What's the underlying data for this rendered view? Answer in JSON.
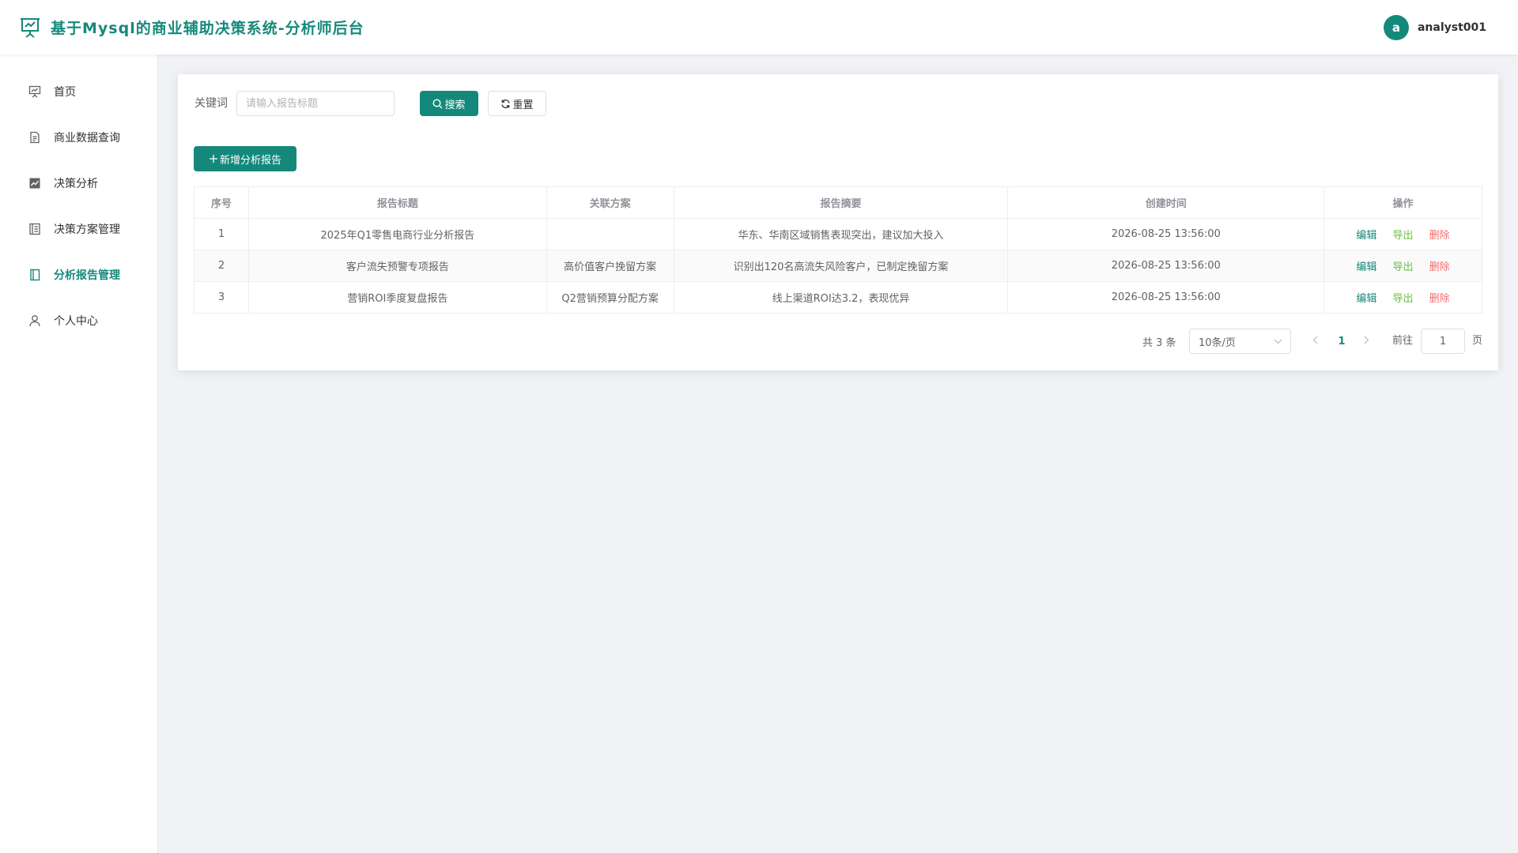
{
  "header": {
    "title": "基于Mysql的商业辅助决策系统-分析师后台",
    "avatar_letter": "a",
    "username": "analyst001"
  },
  "sidebar": {
    "items": [
      {
        "label": "首页",
        "icon": "presentation-icon",
        "active": false
      },
      {
        "label": "商业数据查询",
        "icon": "document-icon",
        "active": false
      },
      {
        "label": "决策分析",
        "icon": "chart-icon",
        "active": false
      },
      {
        "label": "决策方案管理",
        "icon": "list-document-icon",
        "active": false
      },
      {
        "label": "分析报告管理",
        "icon": "notebook-icon",
        "active": true
      },
      {
        "label": "个人中心",
        "icon": "user-icon",
        "active": false
      }
    ]
  },
  "filter": {
    "keyword_label": "关键词",
    "keyword_placeholder": "请输入报告标题",
    "search_label": "搜索",
    "reset_label": "重置"
  },
  "toolbar": {
    "add_label": "新增分析报告"
  },
  "table": {
    "columns": [
      "序号",
      "报告标题",
      "关联方案",
      "报告摘要",
      "创建时间",
      "操作"
    ],
    "rows": [
      {
        "index": "1",
        "title": "2025年Q1零售电商行业分析报告",
        "plan": "",
        "summary": "华东、华南区域销售表现突出，建议加大投入",
        "created": "2026-08-25 13:56:00"
      },
      {
        "index": "2",
        "title": "客户流失预警专项报告",
        "plan": "高价值客户挽留方案",
        "summary": "识别出120名高流失风险客户，已制定挽留方案",
        "created": "2026-08-25 13:56:00"
      },
      {
        "index": "3",
        "title": "营销ROI季度复盘报告",
        "plan": "Q2营销预算分配方案",
        "summary": "线上渠道ROI达3.2，表现优异",
        "created": "2026-08-25 13:56:00"
      }
    ],
    "actions": {
      "edit": "编辑",
      "export": "导出",
      "delete": "删除"
    }
  },
  "pagination": {
    "total_text": "共 3 条",
    "page_size": "10条/页",
    "current_page": "1",
    "goto_label": "前往",
    "goto_value": "1",
    "page_unit": "页"
  },
  "colors": {
    "primary": "#14897b",
    "export": "#67c23a",
    "delete": "#f56c6c"
  }
}
